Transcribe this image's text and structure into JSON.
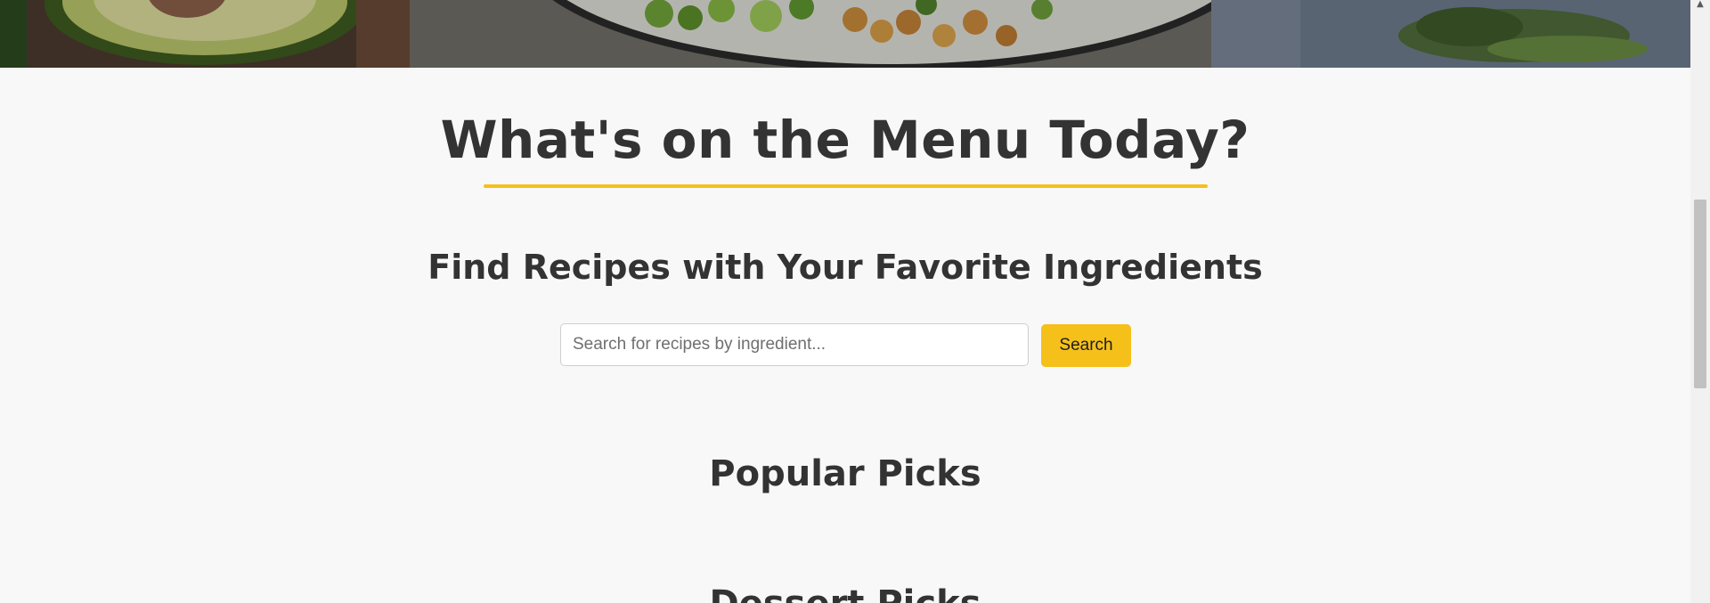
{
  "hero": {
    "image_icon": "food-bowl-photo"
  },
  "main": {
    "title": "What's on the Menu Today?",
    "subtitle": "Find Recipes with Your Favorite Ingredients",
    "search": {
      "placeholder": "Search for recipes by ingredient...",
      "value": "",
      "button_label": "Search"
    },
    "sections": [
      {
        "heading": "Popular Picks"
      },
      {
        "heading": "Dessert Picks"
      }
    ]
  },
  "colors": {
    "accent": "#f5c01a",
    "background": "#f8f8f8",
    "text": "#333333"
  },
  "scrollbar": {
    "up_arrow_icon": "chevron-up-icon"
  }
}
